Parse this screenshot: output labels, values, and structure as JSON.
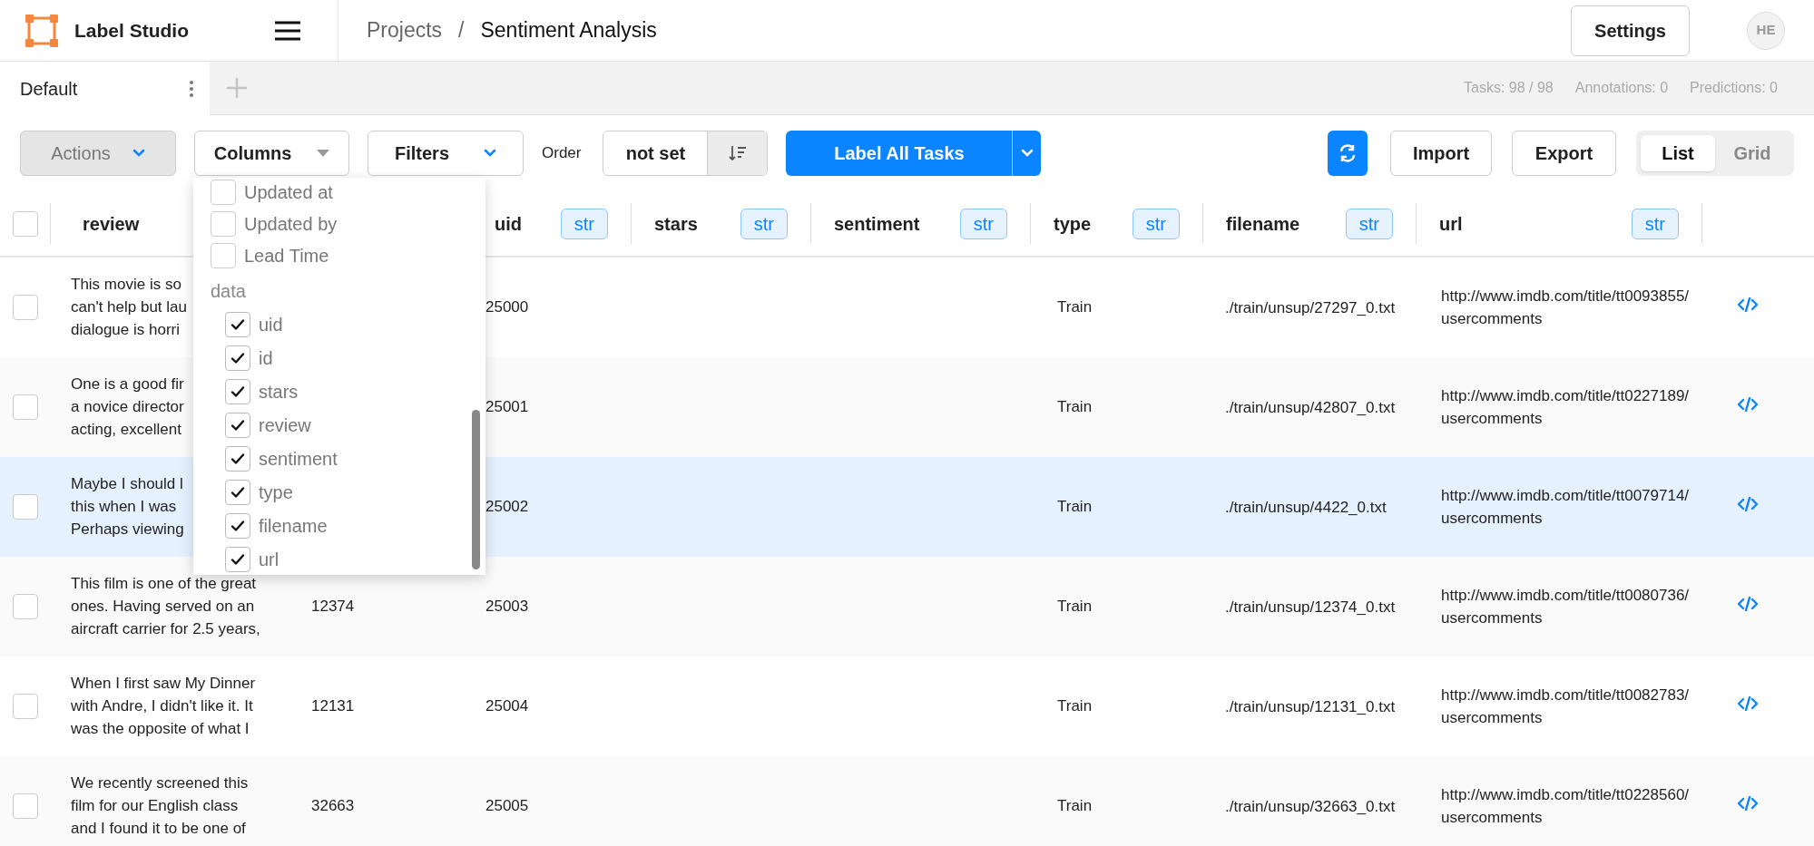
{
  "app": {
    "name": "Label Studio"
  },
  "breadcrumb": [
    {
      "label": "Projects"
    },
    {
      "label": "/"
    },
    {
      "label": "Sentiment Analysis"
    }
  ],
  "settings_button": "Settings",
  "avatar": "HE",
  "tabs": [
    {
      "label": "Default",
      "selected": true
    }
  ],
  "stats": [
    "Tasks: 98 / 98",
    "Annotations: 0",
    "Predictions: 0"
  ],
  "toolbar": {
    "actions": {
      "label": "Actions",
      "disabled": true
    },
    "columns": {
      "label": "Columns",
      "expanded": true
    },
    "filters": {
      "label": "Filters"
    },
    "order_label": "Order",
    "order_value": "not set",
    "label_all": "Label All Tasks",
    "import": "Import",
    "export": "Export",
    "views": [
      {
        "label": "List",
        "selected": true
      },
      {
        "label": "Grid",
        "selected": false
      }
    ]
  },
  "columns_menu": {
    "items": [
      {
        "label": "Updated at",
        "checked": false
      },
      {
        "label": "Updated by",
        "checked": false
      },
      {
        "label": "Lead Time",
        "checked": false
      }
    ],
    "sections": [
      {
        "title": "data",
        "items": [
          {
            "label": "uid",
            "checked": true
          },
          {
            "label": "id",
            "checked": true
          },
          {
            "label": "stars",
            "checked": true
          },
          {
            "label": "review",
            "checked": true
          },
          {
            "label": "sentiment",
            "checked": true
          },
          {
            "label": "type",
            "checked": true
          },
          {
            "label": "filename",
            "checked": true
          },
          {
            "label": "url",
            "checked": true
          }
        ]
      }
    ]
  },
  "table": {
    "header_checked": false,
    "columns": [
      {
        "name": "review"
      },
      {
        "name": "uid",
        "type": "str"
      },
      {
        "name": "stars",
        "type": "str"
      },
      {
        "name": "sentiment",
        "type": "str"
      },
      {
        "name": "type",
        "type": "str"
      },
      {
        "name": "filename",
        "type": "str"
      },
      {
        "name": "url",
        "type": "str"
      }
    ],
    "rows": [
      {
        "checked": false,
        "highlighted": false,
        "review": "This movie is so\ncan't help but lau\ndialogue is horri",
        "uid": "25000",
        "type": "Train",
        "filename": "./train/unsup/27297_0.txt",
        "url": "http://www.imdb.com/title/tt0093855/usercomments"
      },
      {
        "checked": false,
        "highlighted": false,
        "review": "One is a good fir\na novice director\nacting, excellent",
        "uid": "25001",
        "type": "Train",
        "filename": "./train/unsup/42807_0.txt",
        "url": "http://www.imdb.com/title/tt0227189/usercomments"
      },
      {
        "checked": false,
        "highlighted": true,
        "review": "Maybe I should l\nthis when I was\nPerhaps viewing",
        "uid": "25002",
        "type": "Train",
        "filename": "./train/unsup/4422_0.txt",
        "url": "http://www.imdb.com/title/tt0079714/usercomments"
      },
      {
        "checked": false,
        "highlighted": false,
        "review": "This film is one of the great\nones. Having served on an\naircraft carrier for 2.5 years,",
        "id": "12374",
        "uid": "25003",
        "type": "Train",
        "filename": "./train/unsup/12374_0.txt",
        "url": "http://www.imdb.com/title/tt0080736/usercomments"
      },
      {
        "checked": false,
        "highlighted": false,
        "review": "When I first saw My Dinner\nwith Andre, I didn't like it. It\nwas the opposite of what I",
        "id": "12131",
        "uid": "25004",
        "type": "Train",
        "filename": "./train/unsup/12131_0.txt",
        "url": "http://www.imdb.com/title/tt0082783/usercomments"
      },
      {
        "checked": false,
        "highlighted": false,
        "review": "We recently screened this\nfilm for our English class\nand I found it to be one of",
        "id": "32663",
        "uid": "25005",
        "type": "Train",
        "filename": "./train/unsup/32663_0.txt",
        "url": "http://www.imdb.com/title/tt0228560/usercomments"
      }
    ]
  }
}
